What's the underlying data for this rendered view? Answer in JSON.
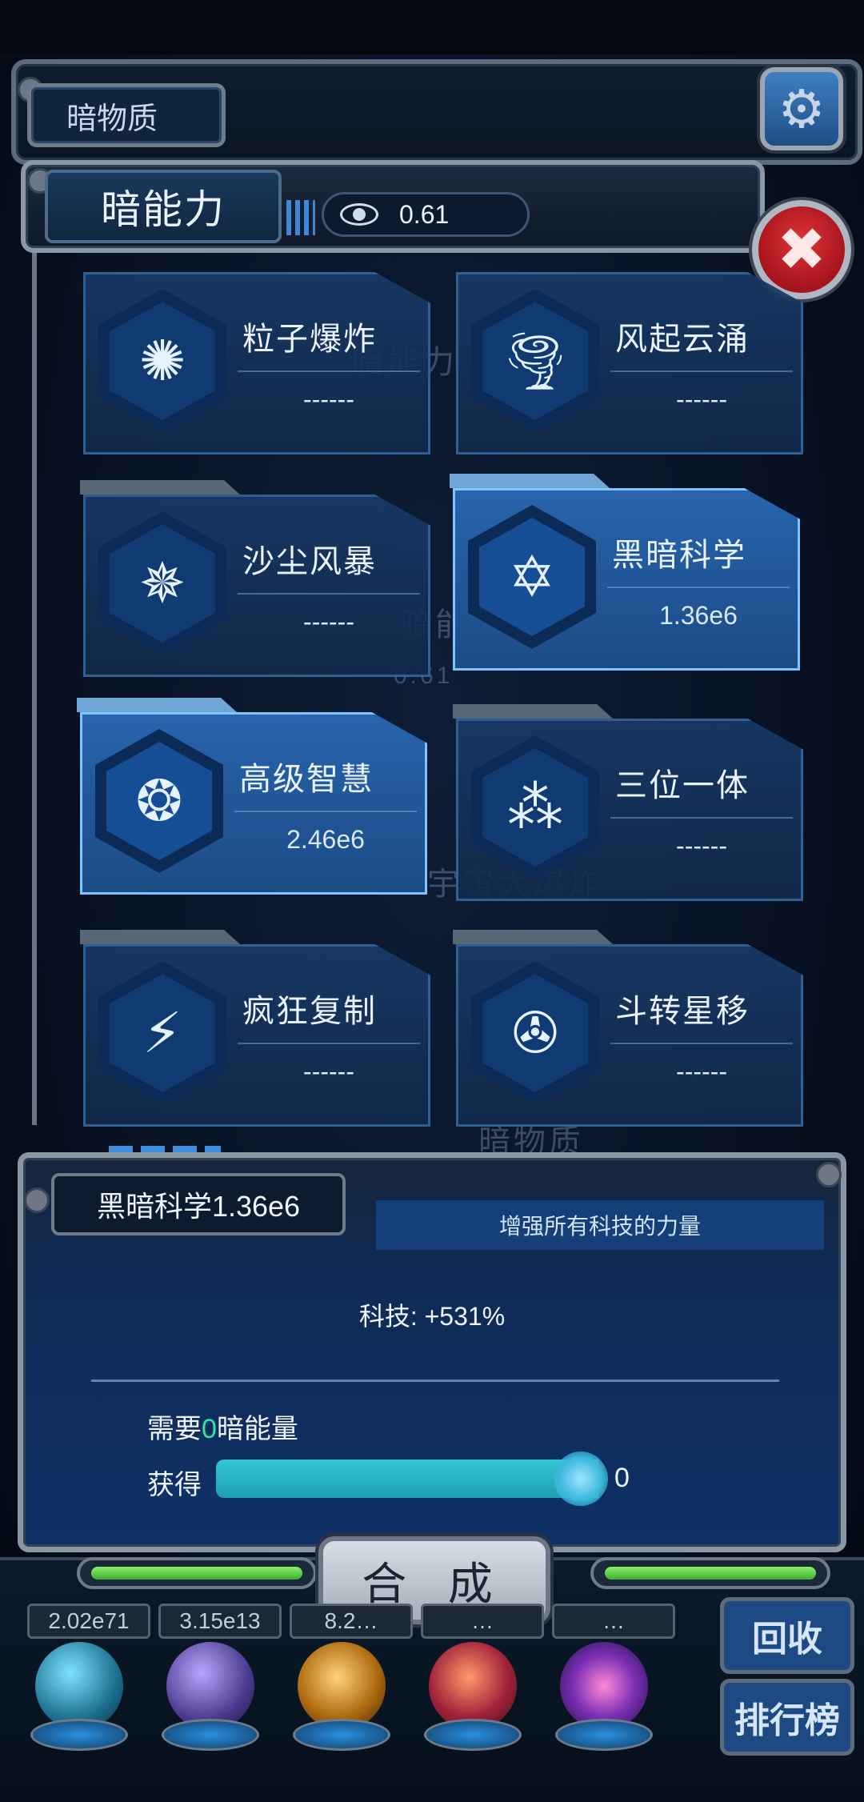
{
  "header": {
    "dark_matter_tab": "暗物质",
    "dialog_title": "暗能力",
    "resource_value": "0.61"
  },
  "ghost_text": {
    "g1": "暗能力",
    "g2": "暗能",
    "g3": "0.61",
    "g4": "宇宙大爆炸",
    "g5": "暗物质"
  },
  "skills": [
    {
      "name": "粒子爆炸",
      "value": "------",
      "icon": "particle-explosion-icon",
      "active": false
    },
    {
      "name": "风起云涌",
      "value": "------",
      "icon": "tornado-icon",
      "active": false
    },
    {
      "name": "沙尘风暴",
      "value": "------",
      "icon": "sandstorm-icon",
      "active": false
    },
    {
      "name": "黑暗科学",
      "value": "1.36e6",
      "icon": "hexagram-icon",
      "active": true
    },
    {
      "name": "高级智慧",
      "value": "2.46e6",
      "icon": "brain-icon",
      "active": true
    },
    {
      "name": "三位一体",
      "value": "------",
      "icon": "trinity-icon",
      "active": false
    },
    {
      "name": "疯狂复制",
      "value": "------",
      "icon": "lightning-icon",
      "active": false
    },
    {
      "name": "斗转星移",
      "value": "------",
      "icon": "vortex-icon",
      "active": false
    }
  ],
  "info": {
    "title": "黑暗科学1.36e6",
    "description": "增强所有科技的力量",
    "effect": "科技: +531%",
    "need_prefix": "需要",
    "need_amount": "0",
    "need_suffix": "暗能量",
    "gain_label": "获得",
    "gain_value": "0",
    "gain_fill": 0.98
  },
  "dock": {
    "synthesize_label": "合 成",
    "counts": [
      "2.02e71",
      "3.15e13",
      "8.2…",
      "…",
      "…"
    ],
    "side_buttons": [
      "回收",
      "排行榜"
    ]
  },
  "colors": {
    "accent": "#2fe6a9",
    "card_bg": "#183a67",
    "card_active": "#2864ad",
    "close": "#d42a32"
  }
}
